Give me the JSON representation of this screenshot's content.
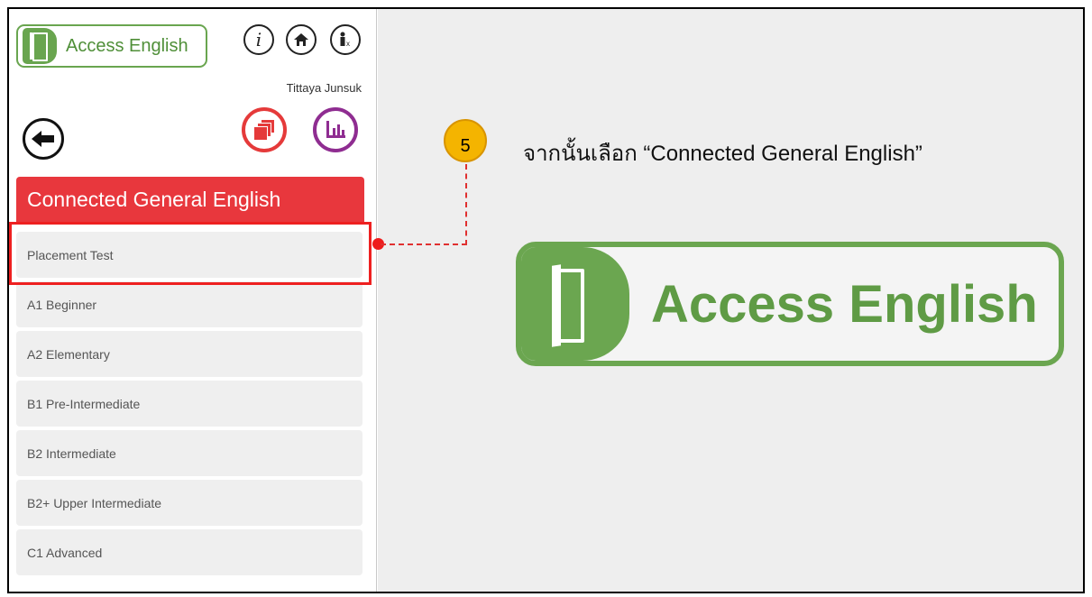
{
  "sidebar": {
    "logo_text": "Access English",
    "user_name": "Tittaya Junsuk",
    "icons": {
      "info": "i",
      "home": "⌂",
      "profile": "i"
    },
    "course_title": "Connected General English",
    "levels": [
      "Placement Test",
      "A1 Beginner",
      "A2 Elementary",
      "B1 Pre-Intermediate",
      "B2 Intermediate",
      "B2+ Upper Intermediate",
      "C1 Advanced"
    ]
  },
  "annotation": {
    "step_number": "5",
    "instruction": "จากนั้นเลือก “Connected General English”"
  },
  "main": {
    "logo_text": "Access English"
  },
  "colors": {
    "brand_green": "#6ba650",
    "course_red": "#e8373d",
    "stats_purple": "#8f2d91",
    "step_yellow": "#f4b400"
  }
}
